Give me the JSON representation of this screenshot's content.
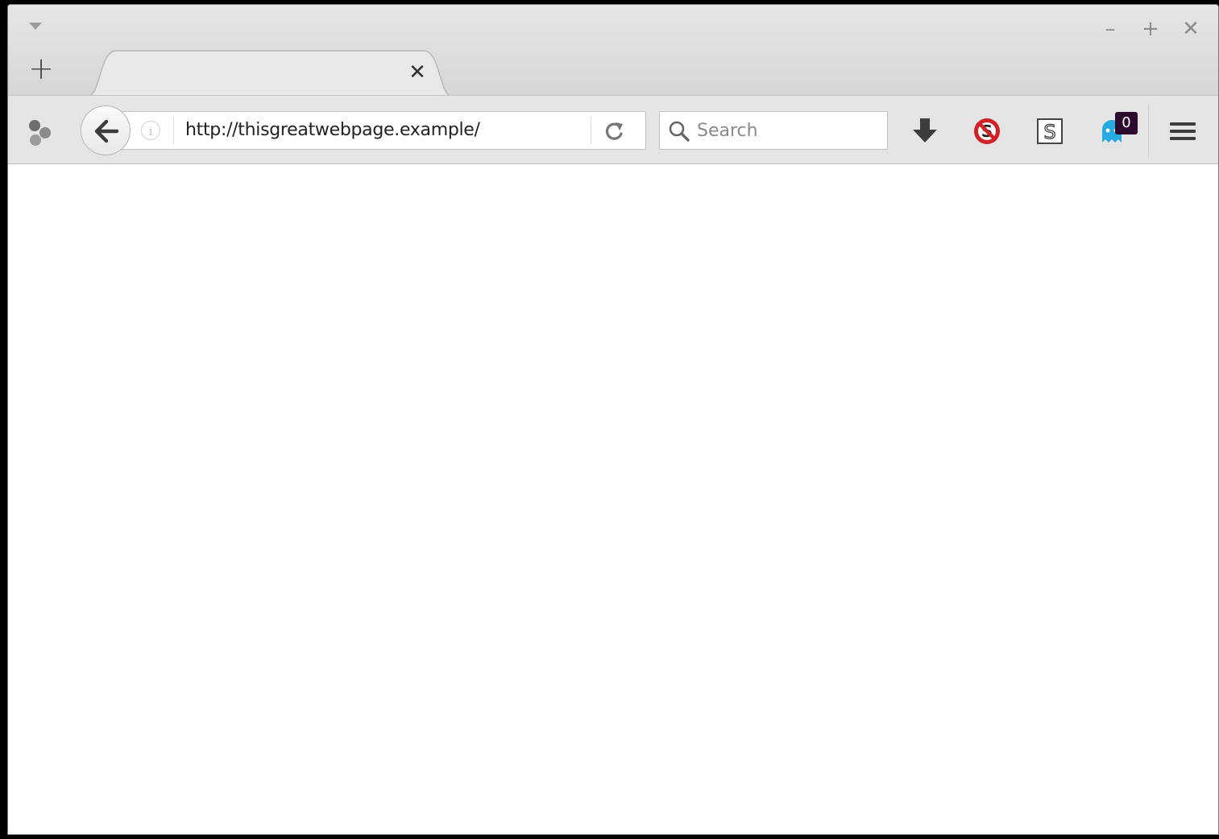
{
  "window": {
    "controls": {
      "minimize": "–",
      "maximize": "+",
      "close": "✕"
    }
  },
  "tabstrip": {
    "new_tab": "+",
    "tabs": [
      {
        "title": "",
        "close": "✕"
      }
    ]
  },
  "navbar": {
    "url": "http://thisgreatwebpage.example/",
    "search_placeholder": "Search",
    "info": "i",
    "notification_badge": "0"
  },
  "icons": {
    "extension_left": "extension-icon",
    "back": "arrow-left-icon",
    "reload": "reload-icon",
    "search": "magnifier-icon",
    "download": "download-arrow-icon",
    "no_script": "blocked-script-icon",
    "s_extension": "s-box-icon",
    "ghostery": "ghost-icon",
    "menu": "hamburger-icon"
  },
  "colors": {
    "window_bg": "#e5e5e5",
    "badge_bg": "#2c0b2e",
    "block_red": "#d22027",
    "ghost_blue": "#29a9e1"
  }
}
